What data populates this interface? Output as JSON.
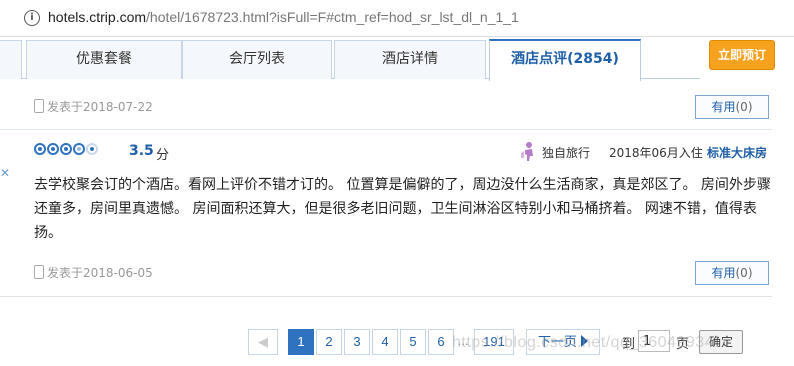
{
  "browser": {
    "url_host": "hotels.ctrip.com",
    "url_path": "/hotel/1678723.html?isFull=F#ctm_ref=hod_sr_lst_dl_n_1_1"
  },
  "tabs": [
    {
      "label": ""
    },
    {
      "label": "优惠套餐"
    },
    {
      "label": "会厅列表"
    },
    {
      "label": "酒店详情"
    },
    {
      "label": "酒店点评(2854)"
    }
  ],
  "book_button": "立即预订",
  "review_prev": {
    "posted": "发表于2018-07-22",
    "useful_label": "有用",
    "useful_count": "(0)"
  },
  "review": {
    "rating_dots": 5,
    "score": "3.5",
    "score_unit": "分",
    "travel_type": "独自旅行",
    "checkin": "2018年06月入住",
    "room_type": "标准大床房",
    "text": "去学校聚会订的个酒店。看网上评价不错才订的。 位置算是偏僻的了，周边没什么生活商家，真是郊区了。 房间外步骤还童多，房间里真遗憾。 房间面积还算大，但是很多老旧问题，卫生间淋浴区特别小和马桶挤着。 网速不错，值得表扬。",
    "posted": "发表于2018-06-05",
    "useful_label": "有用",
    "useful_count": "(0)"
  },
  "pagination": {
    "prev_label": "◀",
    "pages": [
      "1",
      "2",
      "3",
      "4",
      "5",
      "6",
      "...",
      "191"
    ],
    "next_label": "下一页",
    "goto_prefix": "到",
    "goto_value": "1",
    "goto_suffix": "页",
    "confirm_label": "确定"
  },
  "watermark": "https://blog.csdn.net/qq_36049934",
  "colors": {
    "accent": "#2f73c0",
    "book": "#f6a21e",
    "link": "#1f5fa8"
  }
}
